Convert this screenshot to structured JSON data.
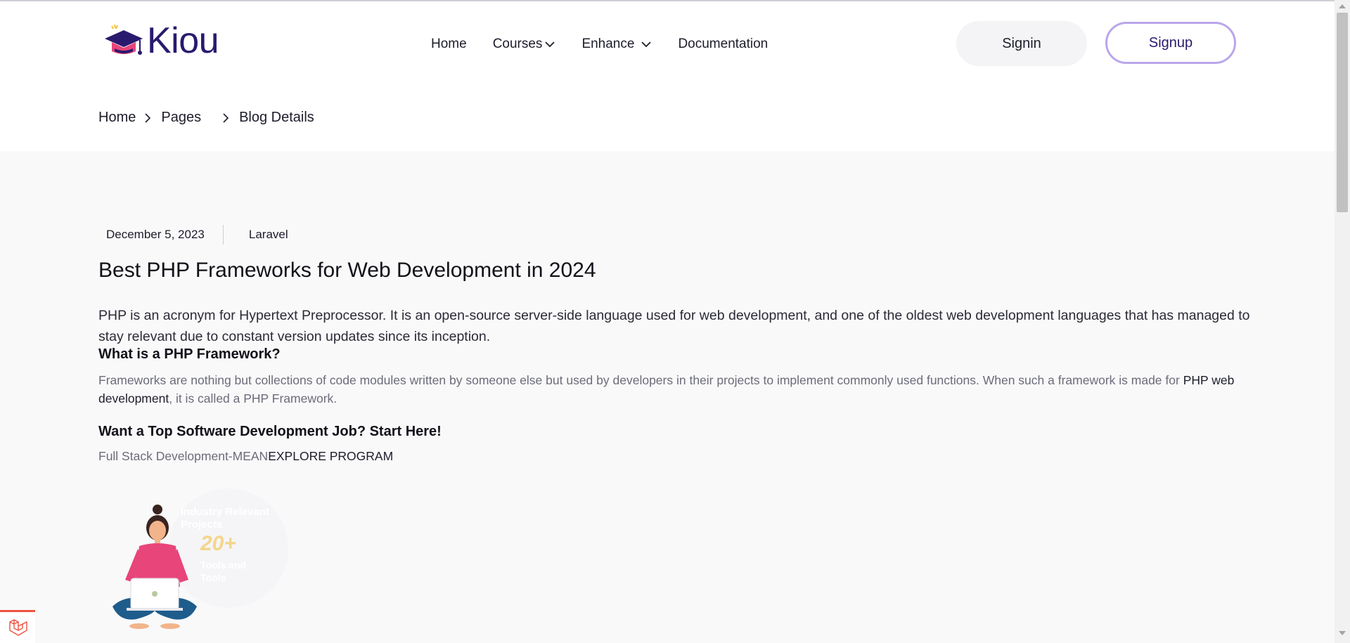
{
  "header": {
    "logo_text": "Kiou",
    "nav": [
      {
        "label": "Home"
      },
      {
        "label": "Courses"
      },
      {
        "label": "Enhance"
      },
      {
        "label": "Documentation"
      }
    ],
    "signin_label": "Signin",
    "signup_label": "Signup"
  },
  "breadcrumb": {
    "items": [
      "Home",
      "Pages",
      "Blog Details"
    ]
  },
  "post": {
    "date": "December 5, 2023",
    "category": "Laravel",
    "title": "Best PHP Frameworks for Web Development in 2024",
    "intro": "PHP is an acronym for Hypertext Preprocessor. It is an open-source server-side language used for web development, and one of the oldest web development languages that has managed to stay relevant due to constant version updates since its inception.",
    "subheading": "What is a PHP Framework?",
    "para_before_link": "Frameworks are nothing but collections of code modules written by someone else but used by developers in their projects to implement commonly used functions. When such a framework is made for ",
    "para_link": "PHP web development",
    "para_after_link": ", it is called a PHP Framework.",
    "promo_heading": "Want a Top Software Development Job? Start Here!",
    "program_name": "Full Stack Development-MEAN",
    "program_cta": "EXPLORE PROGRAM"
  },
  "banner": {
    "line1a": "Industry Relevant",
    "line1b": "Projects",
    "number": "20+",
    "line2a": "Tools and",
    "line2b": "Tools"
  },
  "colors": {
    "brand": "#2a1a6e",
    "signup_border": "#b9a6ea",
    "background_main": "#f9f9fa",
    "accent_yellow": "#f4d58a"
  }
}
